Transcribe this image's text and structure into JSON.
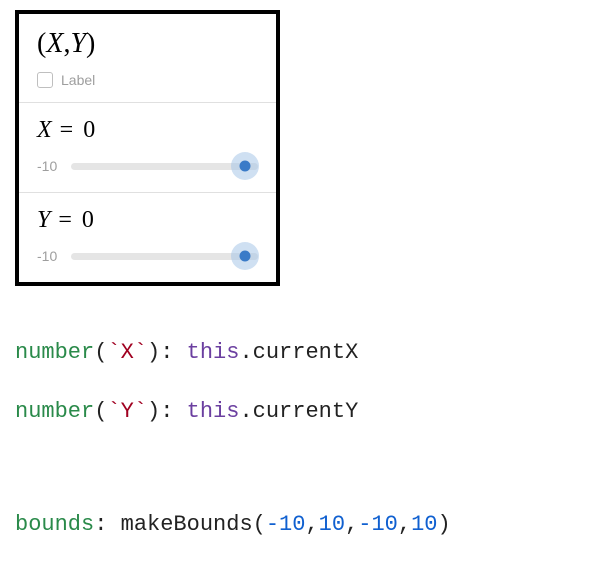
{
  "panel": {
    "pointLabel": "(X,Y)",
    "labelCheckbox": {
      "checked": false,
      "text": "Label"
    },
    "sliders": [
      {
        "variable": "X",
        "value": "0",
        "min": "-10"
      },
      {
        "variable": "Y",
        "value": "0",
        "min": "-10"
      }
    ]
  },
  "code": {
    "line1": {
      "fn": "number",
      "openParen": "(",
      "argStr": "`X`",
      "closeParen": ")",
      "colon": ": ",
      "kw": "this",
      "dot": ".",
      "ident": "currentX"
    },
    "line2": {
      "fn": "number",
      "openParen": "(",
      "argStr": "`Y`",
      "closeParen": ")",
      "colon": ": ",
      "kw": "this",
      "dot": ".",
      "ident": "currentY"
    },
    "line3": {
      "key": "bounds",
      "colon": ": ",
      "fn": "makeBounds",
      "openParen": "(",
      "a1": "-10",
      "c1": ",",
      "a2": "10",
      "c2": ",",
      "a3": "-10",
      "c3": ",",
      "a4": "10",
      "closeParen": ")"
    }
  }
}
